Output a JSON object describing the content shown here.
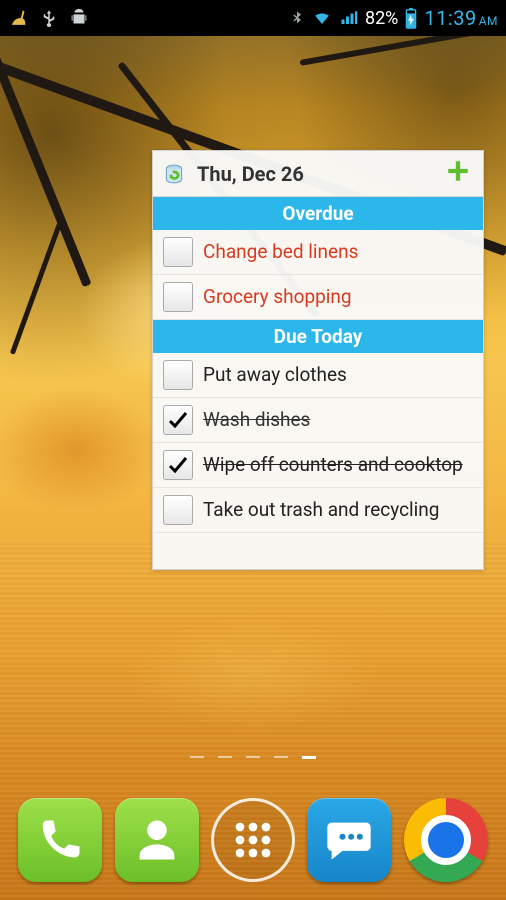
{
  "statusbar": {
    "battery_percent": "82%",
    "time": "11:39",
    "ampm": "AM"
  },
  "widget": {
    "date_label": "Thu, Dec 26",
    "sections": {
      "overdue_label": "Overdue",
      "due_today_label": "Due Today"
    },
    "items": {
      "overdue": [
        {
          "text": "Change bed linens",
          "checked": false
        },
        {
          "text": "Grocery shopping",
          "checked": false
        }
      ],
      "today": [
        {
          "text": "Put away clothes",
          "checked": false
        },
        {
          "text": "Wash dishes",
          "checked": true
        },
        {
          "text": "Wipe off counters and cooktop",
          "checked": true
        },
        {
          "text": "Take out trash and recycling",
          "checked": false
        }
      ]
    }
  },
  "home": {
    "page_count": 5,
    "active_page_index": 4
  },
  "colors": {
    "accent": "#2cb7eb",
    "overdue_text": "#d83a20",
    "add_button": "#5fbf2f"
  }
}
